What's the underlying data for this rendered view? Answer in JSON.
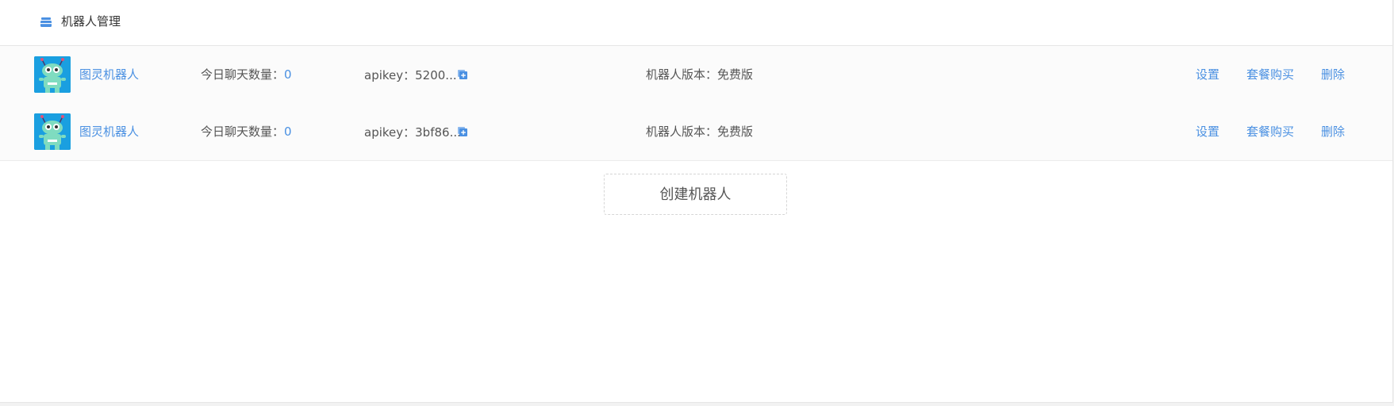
{
  "header": {
    "title": "机器人管理",
    "icon": "robot-management-icon"
  },
  "colors": {
    "accent": "#4a90e2",
    "avatar_bg": "#1a9fe0",
    "robot_green": "#7fdcc0"
  },
  "robots": [
    {
      "name": "图灵机器人",
      "chat_label": "今日聊天数量：",
      "chat_count": "0",
      "apikey_text": "apikey：5200...",
      "version_text": "机器人版本：免费版",
      "actions": {
        "settings": "设置",
        "buy": "套餐购买",
        "delete": "删除"
      }
    },
    {
      "name": "图灵机器人",
      "chat_label": "今日聊天数量：",
      "chat_count": "0",
      "apikey_text": "apikey：3bf86...",
      "version_text": "机器人版本：免费版",
      "actions": {
        "settings": "设置",
        "buy": "套餐购买",
        "delete": "删除"
      }
    }
  ],
  "create_button": "创建机器人"
}
